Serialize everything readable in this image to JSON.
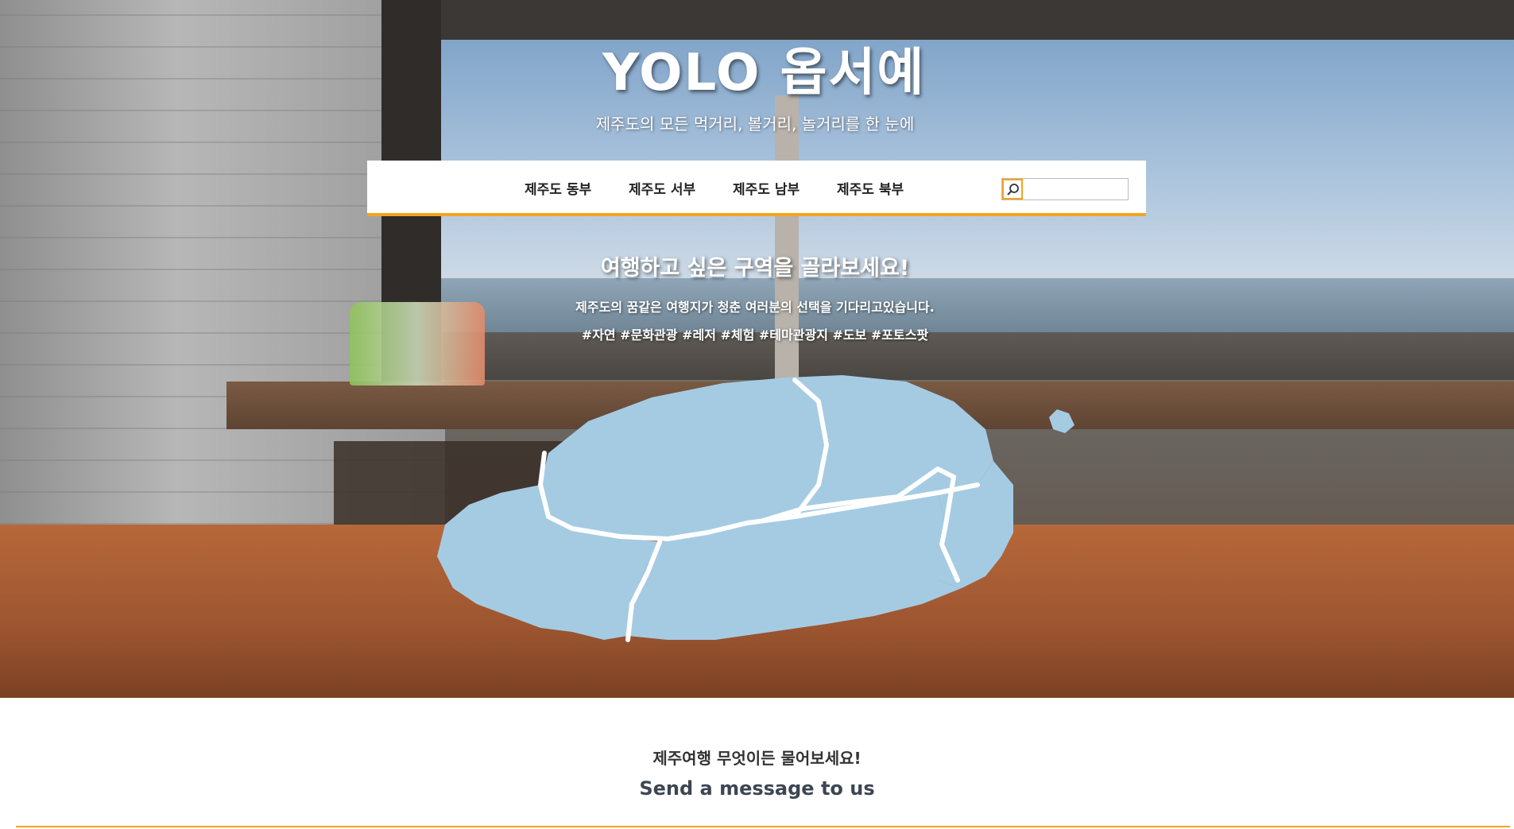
{
  "header": {
    "site_title": "YOLO 옵서예",
    "tagline": "제주도의 모든 먹거리, 볼거리, 놀거리를 한 눈에"
  },
  "nav": {
    "items": [
      {
        "label": "제주도 동부"
      },
      {
        "label": "제주도 서부"
      },
      {
        "label": "제주도 남부"
      },
      {
        "label": "제주도 북부"
      }
    ],
    "search": {
      "placeholder": "",
      "value": "",
      "icon": "search-icon"
    }
  },
  "hero": {
    "heading": "여행하고 싶은 구역을 골라보세요!",
    "description": "제주도의 꿈같은 여행지가 청춘 여러분의 선택을 기다리고있습니다.",
    "tags": "#자연 #문화관광 #레저 #체험 #테마관광지 #도보 #포토스팟"
  },
  "map": {
    "region_color": "#a5cbe3",
    "border_color": "#ffffff"
  },
  "contact": {
    "title": "제주여행 무엇이든 물어보세요!",
    "subtitle": "Send a message to us"
  },
  "colors": {
    "accent": "#f5a41e"
  }
}
